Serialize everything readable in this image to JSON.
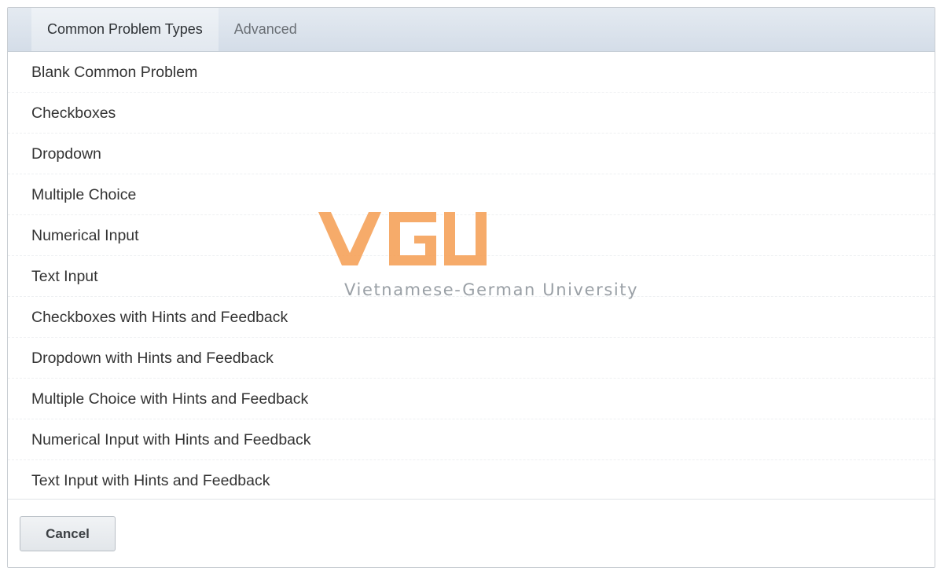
{
  "tabs": [
    {
      "label": "Common Problem Types",
      "active": true
    },
    {
      "label": "Advanced",
      "active": false
    }
  ],
  "problem_types": [
    {
      "label": "Blank Common Problem"
    },
    {
      "label": "Checkboxes"
    },
    {
      "label": "Dropdown"
    },
    {
      "label": "Multiple Choice"
    },
    {
      "label": "Numerical Input"
    },
    {
      "label": "Text Input"
    },
    {
      "label": "Checkboxes with Hints and Feedback"
    },
    {
      "label": "Dropdown with Hints and Feedback"
    },
    {
      "label": "Multiple Choice with Hints and Feedback"
    },
    {
      "label": "Numerical Input with Hints and Feedback"
    },
    {
      "label": "Text Input with Hints and Feedback"
    }
  ],
  "footer": {
    "cancel_label": "Cancel"
  },
  "watermark": {
    "logo_text": "VGU",
    "caption": "Vietnamese-German University",
    "logo_color": "#f6a25a"
  }
}
